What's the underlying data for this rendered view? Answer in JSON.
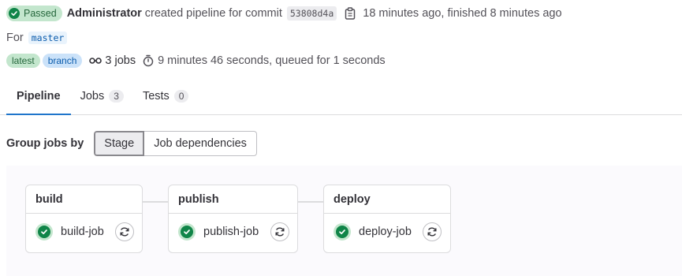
{
  "header": {
    "status": "Passed",
    "author": "Administrator",
    "created_text": "created pipeline for commit",
    "commit_sha": "53808d4a",
    "time_text": "18 minutes ago, finished 8 minutes ago"
  },
  "ref": {
    "prefix": "For",
    "branch": "master"
  },
  "meta": {
    "badge_latest": "latest",
    "badge_branch": "branch",
    "jobs_count": "3 jobs",
    "duration": "9 minutes 46 seconds, queued for 1 seconds"
  },
  "tabs": [
    {
      "label": "Pipeline"
    },
    {
      "label": "Jobs",
      "count": "3"
    },
    {
      "label": "Tests",
      "count": "0"
    }
  ],
  "group_by": {
    "label": "Group jobs by",
    "options": [
      "Stage",
      "Job dependencies"
    ],
    "selected": "Stage"
  },
  "stages": [
    {
      "name": "build",
      "job": "build-job",
      "status": "success"
    },
    {
      "name": "publish",
      "job": "publish-job",
      "status": "success"
    },
    {
      "name": "deploy",
      "job": "deploy-job",
      "status": "success"
    }
  ],
  "colors": {
    "success": "#108548",
    "success_bg": "#c3e6cd",
    "tab_accent": "#1f75cb",
    "ref_bg": "#e9f3fc"
  },
  "icons": {
    "status": "check-circle-icon",
    "copy": "copy-to-clipboard-icon",
    "jobs": "pipeline-icon",
    "duration": "timer-icon",
    "retry": "retry-icon"
  }
}
